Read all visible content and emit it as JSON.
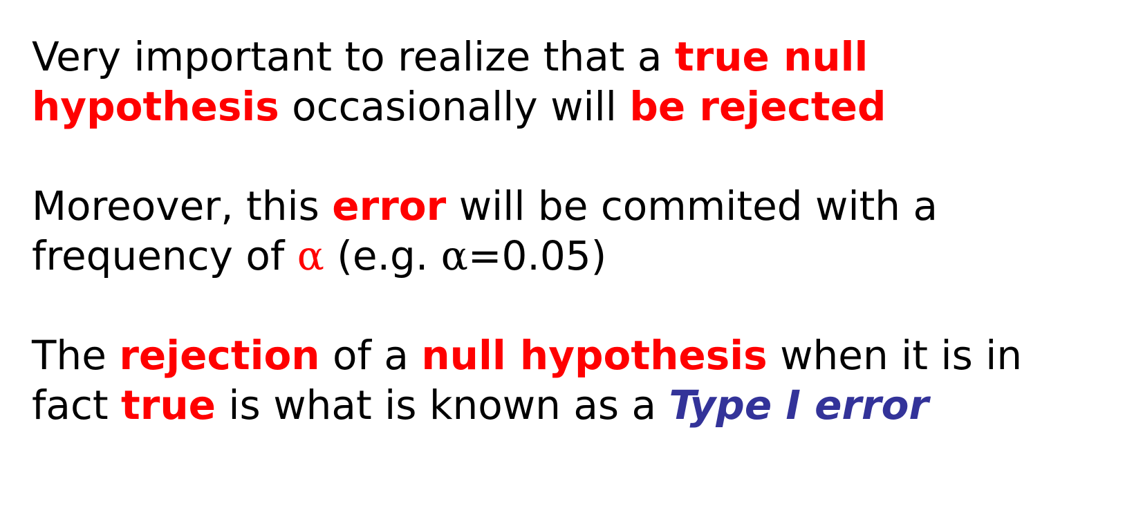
{
  "colors": {
    "text": "#000000",
    "highlight": "#ff0000",
    "term": "#333399",
    "background": "#ffffff"
  },
  "paragraph1": {
    "line1": {
      "t1": "Very important to realize that a ",
      "h1": "true null"
    },
    "line2": {
      "h1": "hypothesis",
      "t1": " occasionally will ",
      "h2": "be rejected"
    }
  },
  "paragraph2": {
    "line1": {
      "t1": "Moreover, this ",
      "h1": "error",
      "t2": " will be commited with a"
    },
    "line2": {
      "t1": "frequency of ",
      "alpha_symbol": "α",
      "t2": " (e.g. ",
      "alpha_symbol_2": "α",
      "t3": "=0.05)"
    }
  },
  "paragraph3": {
    "line1": {
      "t1": "The ",
      "h1": "rejection",
      "t2": " of a ",
      "h2": "null hypothesis",
      "t3": " when it is in"
    },
    "line2": {
      "t1": "fact ",
      "h1": "true",
      "t2": " is what is known as a ",
      "term": "Type I error"
    }
  }
}
